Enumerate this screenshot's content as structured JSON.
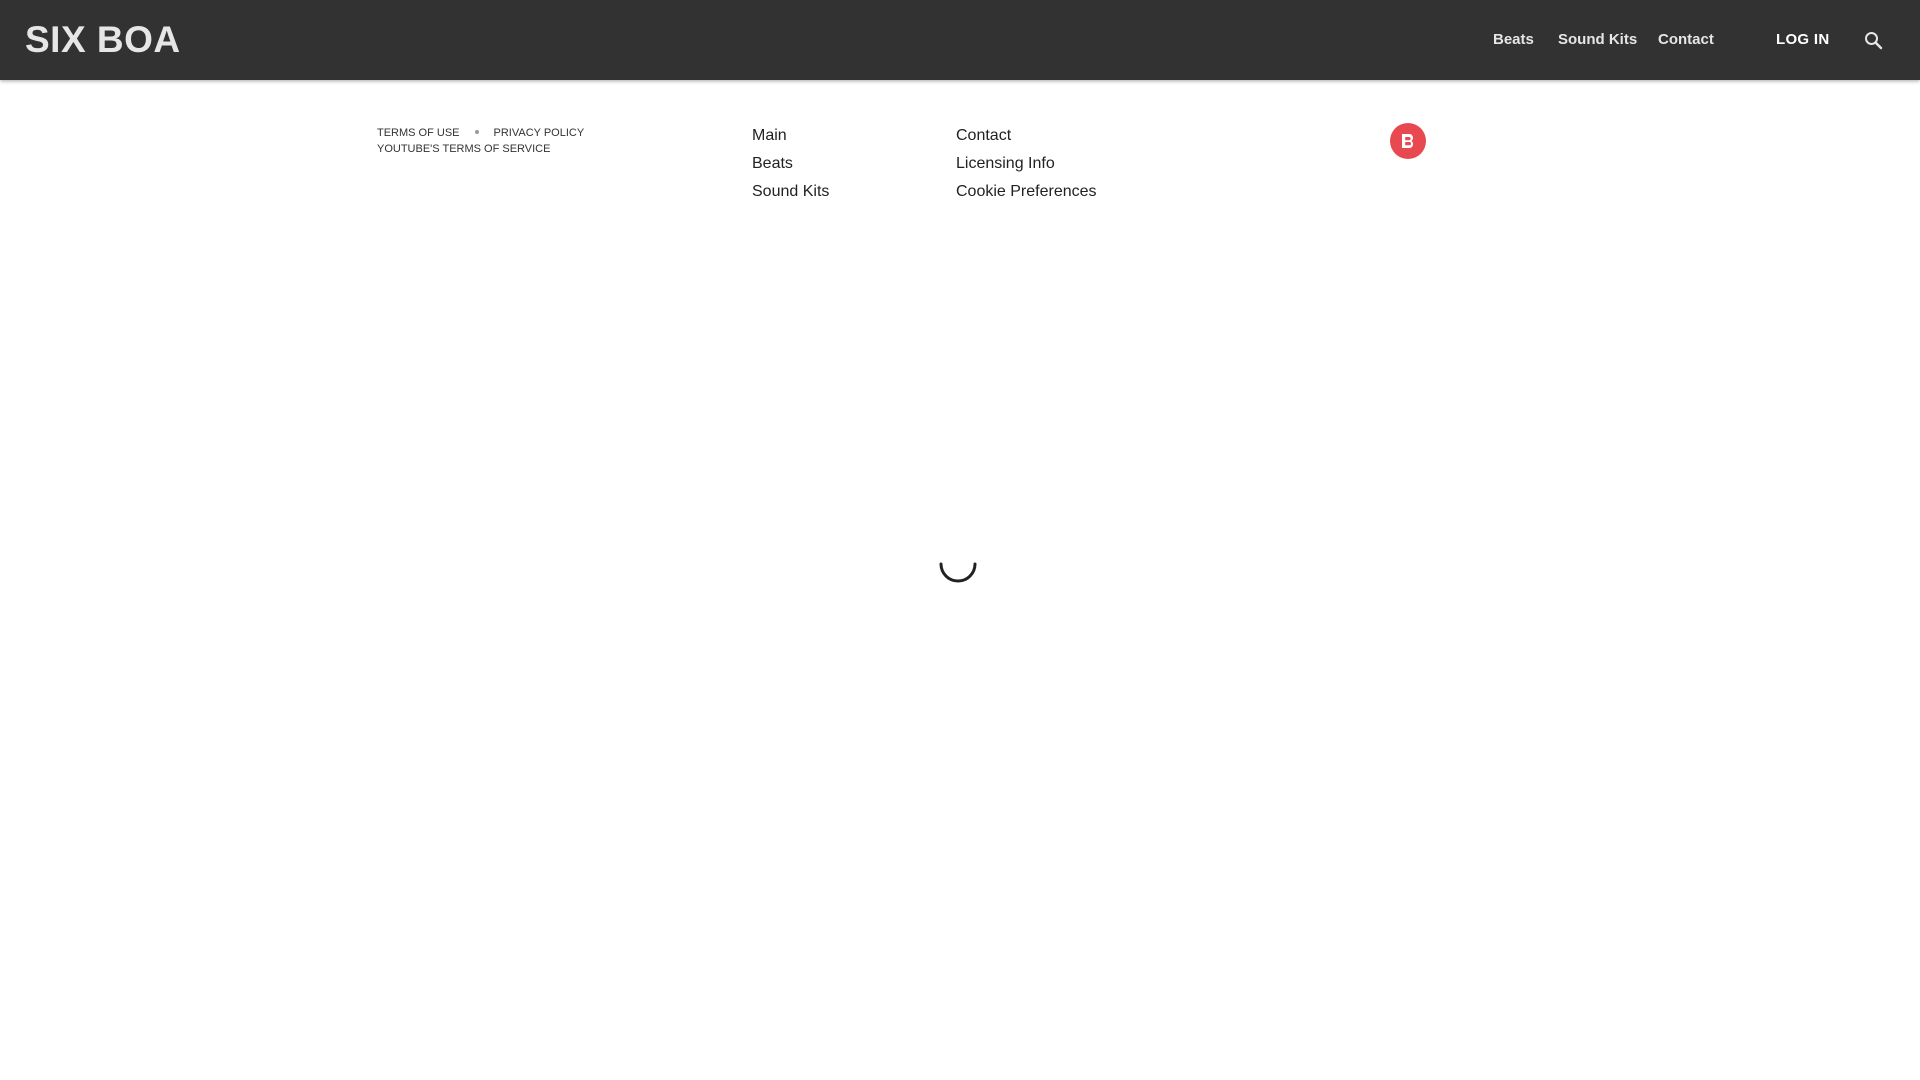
{
  "header": {
    "brand": "SIX BOA",
    "nav": [
      {
        "label": "Beats"
      },
      {
        "label": "Sound Kits"
      },
      {
        "label": "Contact"
      }
    ],
    "login_label": "LOG IN",
    "search_icon": "search-icon"
  },
  "footer": {
    "legal": {
      "terms": "TERMS OF USE",
      "privacy": "PRIVACY POLICY",
      "youtube_terms": "YOUTUBE'S TERMS OF SERVICE"
    },
    "col1": [
      "Main",
      "Beats",
      "Sound Kits"
    ],
    "col2": [
      "Contact",
      "Licensing Info",
      "Cookie Preferences"
    ],
    "badge_icon": "beatstars-icon"
  },
  "colors": {
    "header_bg": "#323232",
    "badge": "#e8484f"
  },
  "loading_icon": "spinner-icon"
}
